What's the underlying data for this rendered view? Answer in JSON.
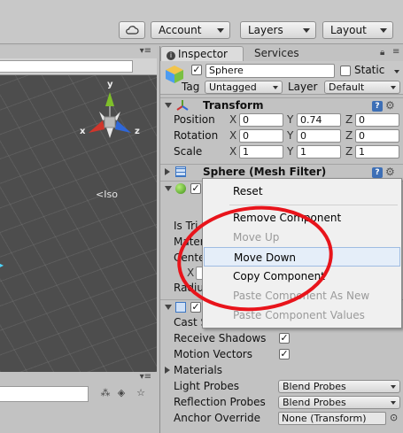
{
  "toolbar": {
    "account_label": "Account",
    "layers_label": "Layers",
    "layout_label": "Layout",
    "cloud_icon": "cloud-icon"
  },
  "scene": {
    "iso_label": "Iso",
    "gizmo_axes": {
      "x": "x",
      "y": "y",
      "z": "z"
    },
    "gizmo_colors": {
      "x": "#d0352b",
      "y": "#7fbf2a",
      "z": "#2f67d8"
    }
  },
  "inspector": {
    "tabs": [
      {
        "label": "Inspector"
      },
      {
        "label": "Services"
      }
    ],
    "object": {
      "name": "Sphere",
      "static_label": "Static",
      "tag_label": "Tag",
      "tag_value": "Untagged",
      "layer_label": "Layer",
      "layer_value": "Default"
    },
    "transform": {
      "title": "Transform",
      "rows": [
        {
          "label": "Position",
          "x": "0",
          "y": "0.74",
          "z": "0"
        },
        {
          "label": "Rotation",
          "x": "0",
          "y": "0",
          "z": "0"
        },
        {
          "label": "Scale",
          "x": "1",
          "y": "1",
          "z": "1"
        }
      ]
    },
    "mesh_filter": {
      "title": "Sphere (Mesh Filter)"
    },
    "collider": {
      "labels": [
        "Is Tri",
        "Mater",
        "Cente",
        "Radiu"
      ],
      "center_x_label": "X"
    },
    "renderer": {
      "cast_label": "Cast S",
      "receive_shadows_label": "Receive Shadows",
      "motion_vectors_label": "Motion Vectors",
      "materials_label": "Materials",
      "light_probes_label": "Light Probes",
      "light_probes_value": "Blend Probes",
      "reflection_probes_label": "Reflection Probes",
      "reflection_probes_value": "Blend Probes",
      "anchor_override_label": "Anchor Override",
      "anchor_override_value": "None (Transform)"
    }
  },
  "context_menu": {
    "items": [
      {
        "label": "Reset",
        "enabled": true
      },
      {
        "label": "Remove Component",
        "enabled": true
      },
      {
        "label": "Move Up",
        "enabled": false
      },
      {
        "label": "Move Down",
        "enabled": true
      },
      {
        "label": "Copy Component",
        "enabled": true
      },
      {
        "label": "Paste Component As New",
        "enabled": false
      },
      {
        "label": "Paste Component Values",
        "enabled": false
      }
    ]
  },
  "annotation": {
    "circle_color": "#e8141b"
  }
}
